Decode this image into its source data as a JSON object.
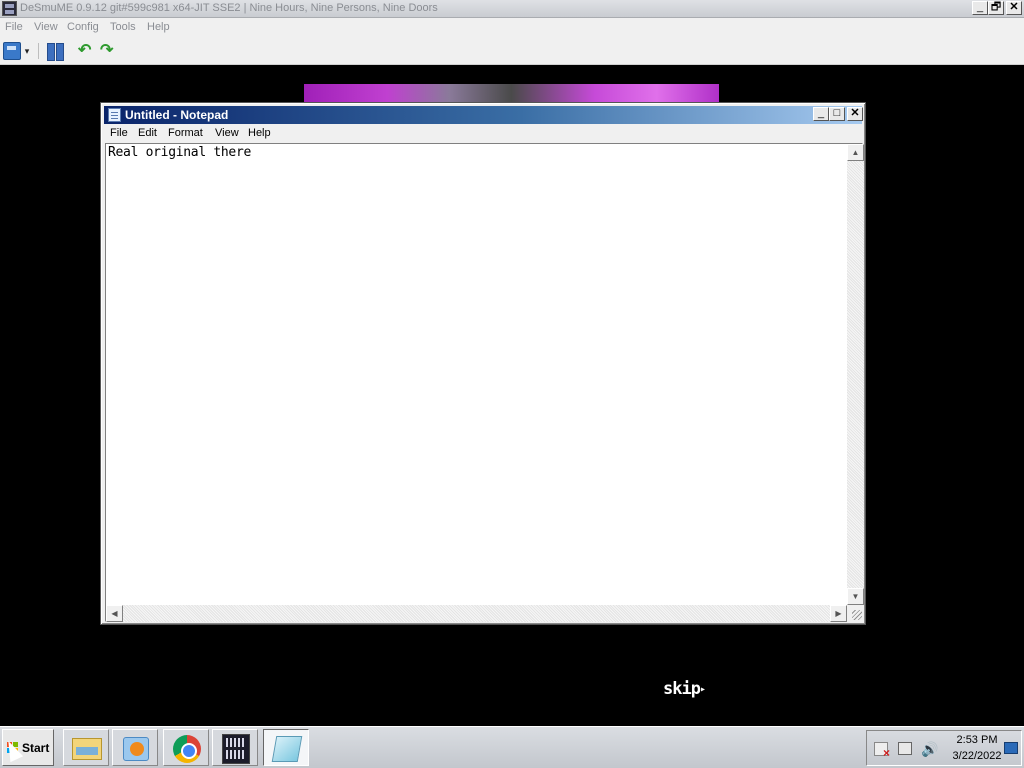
{
  "desmume": {
    "title": "DeSmuME 0.9.12 git#599c981 x64-JIT SSE2 | Nine Hours, Nine Persons, Nine Doors",
    "menu": [
      "File",
      "View",
      "Config",
      "Tools",
      "Help"
    ],
    "controls": {
      "minimize": "_",
      "restore": "🗗",
      "close": "✕"
    },
    "toolbar": {
      "dropdown_glyph": "▾",
      "undo_glyph": "↶",
      "redo_glyph": "↷"
    },
    "game_overlay": {
      "skip_label": "skip",
      "skip_arrow": "▸"
    }
  },
  "notepad": {
    "title": "Untitled - Notepad",
    "menu": [
      "File",
      "Edit",
      "Format",
      "View",
      "Help"
    ],
    "controls": {
      "minimize": "_",
      "maximize": "□",
      "close": "✕"
    },
    "content": "Real original there",
    "scroll": {
      "up": "▲",
      "down": "▼",
      "left": "◀",
      "right": "▶"
    }
  },
  "taskbar": {
    "start_label": "Start",
    "clock": {
      "time": "2:53 PM",
      "date": "3/22/2022"
    },
    "tray": {
      "volume_glyph": "🔊"
    },
    "start_logo_colors": [
      "#f25022",
      "#7fba00",
      "#00a4ef",
      "#ffb900"
    ]
  }
}
